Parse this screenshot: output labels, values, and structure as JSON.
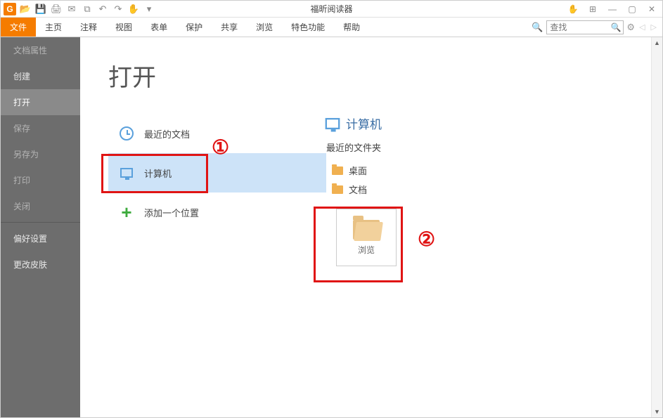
{
  "app": {
    "title": "福昕阅读器",
    "icon_letter": "G"
  },
  "qat": {
    "open": "📂",
    "save": "💾",
    "print": "🖨",
    "mail": "✉",
    "snap": "⧉",
    "undo": "↶",
    "redo": "↷",
    "hand": "✋",
    "drop": "▾"
  },
  "window": {
    "touch": "✋",
    "view": "⊞",
    "min": "—",
    "max": "▢",
    "close": "✕"
  },
  "ribbon": {
    "file": "文件",
    "home": "主页",
    "annotate": "注释",
    "view": "视图",
    "form": "表单",
    "protect": "保护",
    "share": "共享",
    "browse": "浏览",
    "special": "特色功能",
    "help": "帮助"
  },
  "search": {
    "placeholder": "查找",
    "gear": "⚙",
    "left": "◁",
    "right": "▷",
    "find": "🔍"
  },
  "sidebar": {
    "properties": "文档属性",
    "create": "创建",
    "open": "打开",
    "save": "保存",
    "save_as": "另存为",
    "print": "打印",
    "close": "关闭",
    "preferences": "偏好设置",
    "skin": "更改皮肤"
  },
  "page": {
    "heading": "打开",
    "recent_docs": "最近的文档",
    "computer": "计算机",
    "add_place": "添加一个位置"
  },
  "right": {
    "heading": "计算机",
    "recent_folders": "最近的文件夹",
    "desktop": "桌面",
    "documents": "文档",
    "browse": "浏览"
  },
  "annotations": {
    "one": "①",
    "two": "②"
  }
}
